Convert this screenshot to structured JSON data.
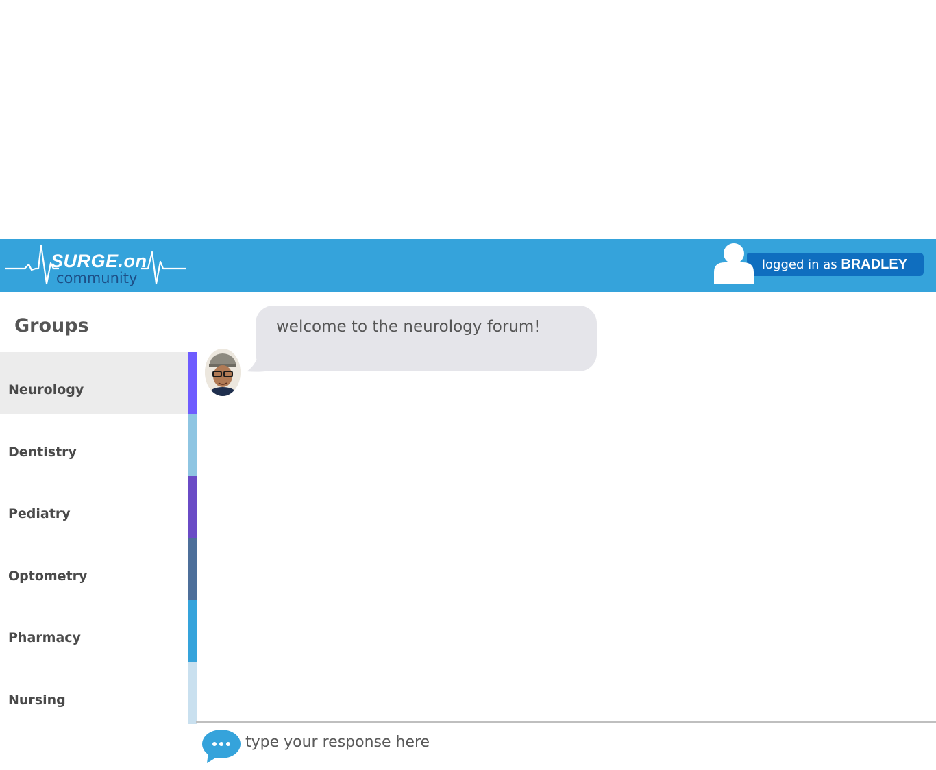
{
  "header": {
    "logo_title": "SURGE.on",
    "logo_subtitle": "community",
    "user_prefix": "logged in as ",
    "user_name": "BRADLEY"
  },
  "sidebar": {
    "title": "Groups",
    "items": [
      {
        "label": "Neurology",
        "color": "#6e5cff",
        "active": true
      },
      {
        "label": "Dentistry",
        "color": "#8ec5e2",
        "active": false
      },
      {
        "label": "Pediatry",
        "color": "#6a4bc6",
        "active": false
      },
      {
        "label": "Optometry",
        "color": "#4d6f9a",
        "active": false
      },
      {
        "label": "Pharmacy",
        "color": "#35a3db",
        "active": false
      },
      {
        "label": "Nursing",
        "color": "#c9e0ef",
        "active": false
      }
    ]
  },
  "chat": {
    "messages": [
      {
        "text": "welcome to the neurology forum!"
      }
    ],
    "input_placeholder": "type your response here"
  },
  "colors": {
    "header": "#35a3db",
    "user_pill": "#0f6ebf",
    "bubble": "#e5e5ea"
  }
}
